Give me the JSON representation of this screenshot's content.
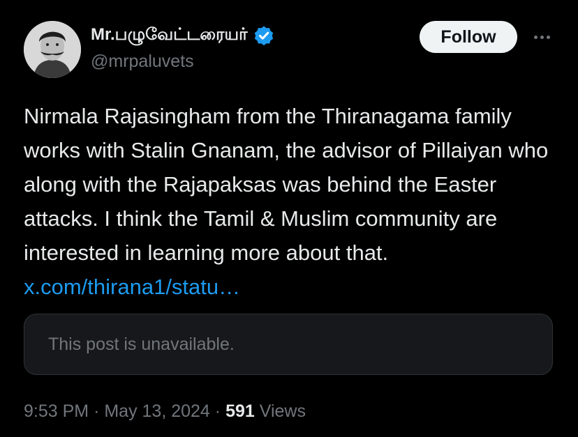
{
  "author": {
    "display_name": "Mr.பழுவேட்டரையர்",
    "handle": "@mrpaluvets",
    "verified": true
  },
  "follow_label": "Follow",
  "more_icon": "more-horizontal-icon",
  "tweet": {
    "text": "Nirmala Rajasingham from the Thiranagama family works with Stalin Gnanam, the advisor of Pillaiyan who along with the Rajapaksas was behind the Easter attacks. I think the Tamil & Muslim community are interested in learning more about that. ",
    "link_text": "x.com/thirana1/statu…"
  },
  "quote": {
    "unavailable_text": "This post is unavailable."
  },
  "meta": {
    "time": "9:53 PM",
    "separator": "·",
    "date": "May 13, 2024",
    "views_count": "591",
    "views_label": "Views"
  },
  "colors": {
    "background": "#000000",
    "text": "#e7e9ea",
    "secondary": "#71767b",
    "link": "#1d9bf0",
    "verified": "#1d9bf0"
  }
}
